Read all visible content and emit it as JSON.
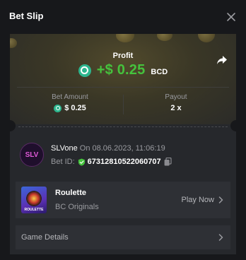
{
  "header": {
    "title": "Bet Slip"
  },
  "profit": {
    "label": "Profit",
    "amount": "+$ 0.25",
    "currency": "BCD"
  },
  "stats": {
    "bet_amount_label": "Bet Amount",
    "bet_amount_value": "$ 0.25",
    "payout_label": "Payout",
    "payout_value": "2 x"
  },
  "user": {
    "avatar_text": "SLV",
    "name": "SLVone",
    "date_text": " On 08.06.2023, 11:06:19",
    "bet_id_label": "Bet ID:",
    "bet_id_value": "67312810522060707"
  },
  "game": {
    "name": "Roulette",
    "provider": "BC Originals",
    "thumb_text": "ROULETTE",
    "play_label": "Play Now"
  },
  "details": {
    "label": "Game Details"
  },
  "colors": {
    "profit_green": "#45c23d",
    "bcd_coin": "#2db68e",
    "card_bg": "#26282c",
    "page_bg": "#17181b"
  }
}
